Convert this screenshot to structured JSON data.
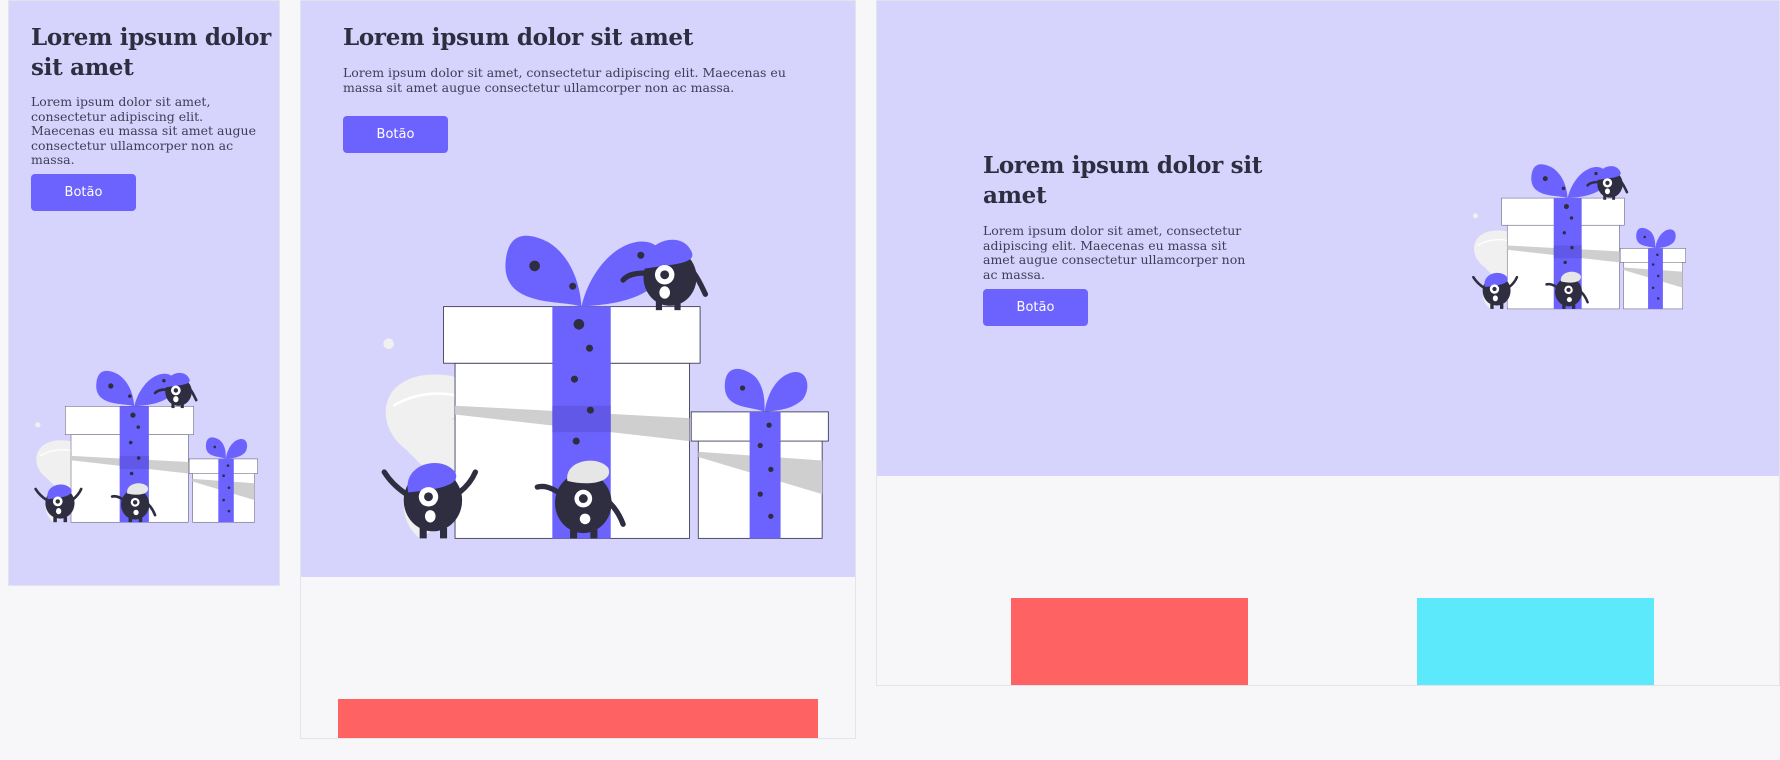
{
  "hero": {
    "title": "Lorem ipsum dolor sit amet",
    "description": "Lorem ipsum dolor sit amet, consectetur adipiscing elit. Maecenas eu massa sit amet augue consectetur ullamcorper non ac massa.",
    "button_label": "Botão"
  },
  "colors": {
    "hero_background": "#d6d3fc",
    "accent": "#6c63ff",
    "dark": "#2f2e41",
    "block_red": "#ff6262",
    "block_cyan": "#5ce9fb",
    "page_background": "#f7f7f9"
  },
  "illustration": {
    "icon": "gift-boxes-with-monsters-illustration"
  }
}
